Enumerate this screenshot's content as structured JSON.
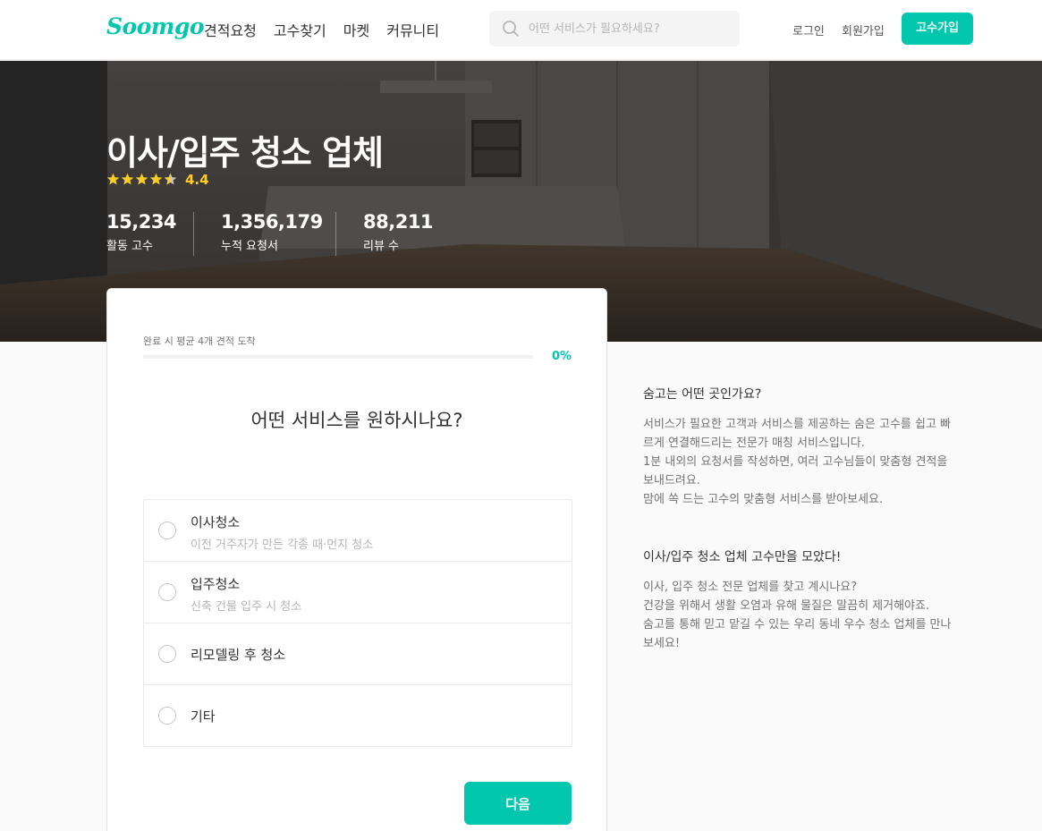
{
  "header": {
    "logo": "Soomgo",
    "nav": [
      "견적요청",
      "고수찾기",
      "마켓",
      "커뮤니티"
    ],
    "search_placeholder": "어떤 서비스가 필요하세요?",
    "login": "로그인",
    "signup": "회원가입",
    "pro_signup": "고수가입"
  },
  "hero": {
    "title": "이사/입주 청소 업체",
    "rating": "4.4",
    "rating_value": 4.4,
    "stats": [
      {
        "value": "15,234",
        "label": "활동 고수"
      },
      {
        "value": "1,356,179",
        "label": "누적 요청서"
      },
      {
        "value": "88,211",
        "label": "리뷰 수"
      }
    ]
  },
  "form": {
    "progress_label": "완료 시 평균 4개 견적 도착",
    "progress_percent": "0%",
    "progress_value": 0,
    "question": "어떤 서비스를 원하시나요?",
    "options": [
      {
        "title": "이사청소",
        "desc": "이전 거주자가 만든 각종 때·먼지 청소"
      },
      {
        "title": "입주청소",
        "desc": "신축 건물 입주 시 청소"
      },
      {
        "title": "리모델링 후 청소",
        "desc": ""
      },
      {
        "title": "기타",
        "desc": ""
      }
    ],
    "next_button": "다음"
  },
  "side": {
    "about_title": "숨고는 어떤 곳인가요?",
    "about_lines": [
      "서비스가 필요한 고객과 서비스를 제공하는 숨은 고수를 쉽고 빠",
      "르게 연결해드리는 전문가 매칭 서비스입니다.",
      "1분 내외의 요청서를 작성하면, 여러 고수님들이 맞춤형 견적을",
      "보내드려요.",
      "맘에 쏙 드는 고수의 맞춤형 서비스를 받아보세요."
    ],
    "category_title": "이사/입주 청소 업체 고수만을 모았다!",
    "category_lines": [
      "이사, 입주 청소 전문 업체를 찾고 계시나요?",
      "건강을 위해서 생활 오염과 유해 물질은 말끔히 제거해야죠.",
      "숨고를 통해 믿고 맡길 수 있는 우리 동네 우수 청소 업체를 만나",
      "보세요!"
    ]
  },
  "colors": {
    "brand": "#00c7ae",
    "star": "#ffce21",
    "text": "#323232",
    "muted": "#737373"
  }
}
